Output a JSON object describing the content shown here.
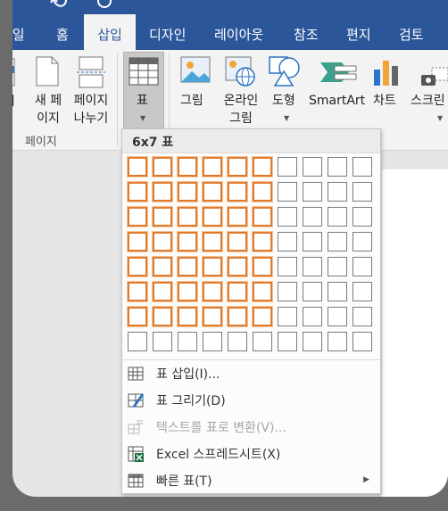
{
  "tabs": [
    "파일",
    "홈",
    "삽입",
    "디자인",
    "레이아웃",
    "참조",
    "편지",
    "검토"
  ],
  "active_tab": "삽입",
  "ribbon": {
    "left_partial": "지",
    "new_page": [
      "새 페",
      "이지"
    ],
    "page_break": [
      "페이지",
      "나누기"
    ],
    "group_pages": "페이지",
    "table": "표",
    "pictures": "그림",
    "online_pictures": [
      "온라인",
      "그림"
    ],
    "shapes": "도형",
    "smartart": "SmartArt",
    "chart": "차트",
    "screenshot": "스크린"
  },
  "table_menu": {
    "header": "6x7 표",
    "grid_columns": 10,
    "grid_rows": 8,
    "selected_columns": 6,
    "selected_rows": 7,
    "items": [
      {
        "label": "표 삽입(I)...",
        "disabled": false
      },
      {
        "label": "표 그리기(D)",
        "disabled": false
      },
      {
        "label": "텍스트를 표로 변환(V)...",
        "disabled": true
      },
      {
        "label": "Excel 스프레드시트(X)",
        "disabled": false
      },
      {
        "label": "빠른 표(T)",
        "disabled": false
      }
    ]
  },
  "colors": {
    "ribbon_blue": "#2b579a",
    "selection_orange": "#e07a2c"
  }
}
